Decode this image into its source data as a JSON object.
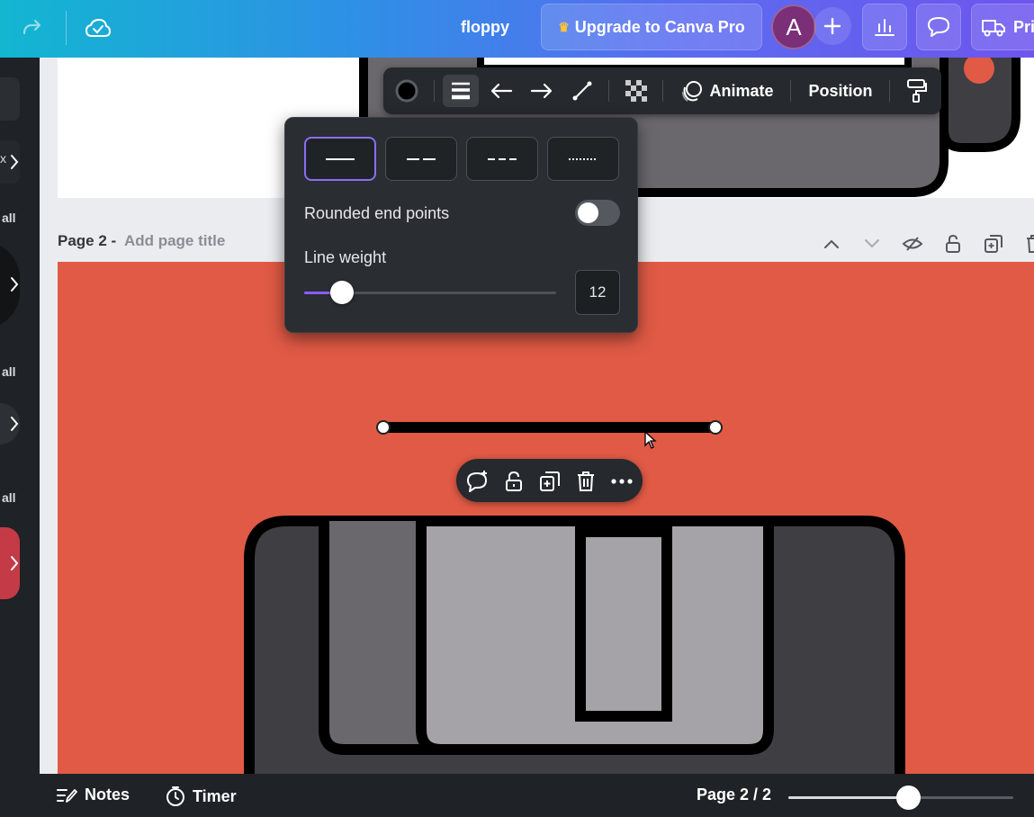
{
  "header": {
    "doc_title": "floppy",
    "upgrade_label": "Upgrade to Canva Pro",
    "avatar_initial": "A",
    "print_label": "Pri",
    "icons": [
      "redo-icon",
      "cloud-saved-icon",
      "crown-icon",
      "plus-icon",
      "analytics-icon",
      "comment-icon",
      "print-truck-icon"
    ]
  },
  "left_panel": {
    "labels": [
      "all",
      "all",
      "all"
    ],
    "x_label": "x"
  },
  "element_toolbar": {
    "animate_label": "Animate",
    "position_label": "Position",
    "icons": [
      "line-color-icon",
      "line-style-icon",
      "arrow-start-icon",
      "arrow-end-icon",
      "line-type-icon",
      "transparency-icon",
      "animate-icon",
      "copy-style-icon"
    ]
  },
  "line_style_popover": {
    "styles": [
      "solid",
      "long-dash",
      "short-dash",
      "dotted"
    ],
    "selected_style": "solid",
    "rounded_label": "Rounded end points",
    "rounded_on": false,
    "weight_label": "Line weight",
    "weight_value": "12",
    "weight_fraction": 0.15
  },
  "page2": {
    "page_label": "Page 2 -",
    "title_placeholder": "Add page title"
  },
  "context_bar": {
    "icons": [
      "comment-add-icon",
      "lock-icon",
      "duplicate-icon",
      "trash-icon",
      "more-icon"
    ]
  },
  "bottom_bar": {
    "notes_label": "Notes",
    "timer_label": "Timer",
    "page_indicator": "Page 2 / 2",
    "zoom_fraction": 0.53
  },
  "colors": {
    "accent": "#8b5cf6",
    "page_bg": "#e05a45",
    "panel_dark": "#26292d"
  }
}
